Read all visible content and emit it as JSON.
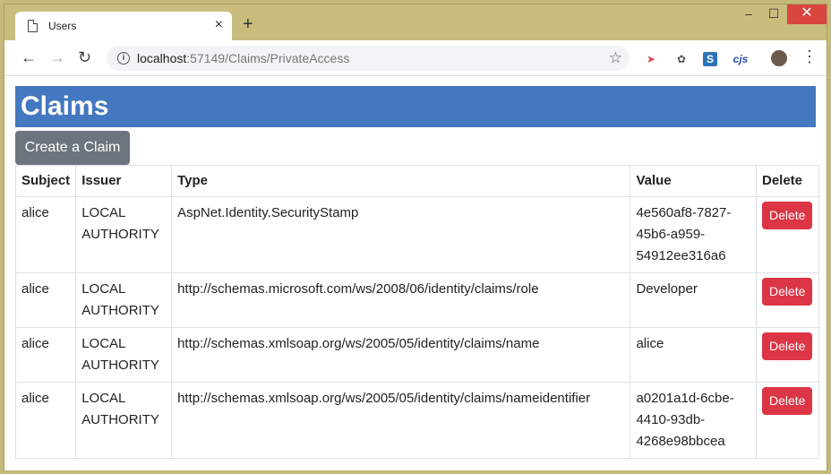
{
  "browser": {
    "tab_title": "Users",
    "tab_close": "×",
    "new_tab": "+",
    "minimize": "–",
    "maximize": "☐",
    "close": "✕",
    "url_host": "localhost",
    "url_path": ":57149/Claims/PrivateAccess",
    "ext4_label": "cjs"
  },
  "page": {
    "title": "Claims",
    "create_button": "Create a Claim",
    "columns": [
      "Subject",
      "Issuer",
      "Type",
      "Value",
      "Delete"
    ],
    "delete_label": "Delete",
    "rows": [
      {
        "subject": "alice",
        "issuer": "LOCAL AUTHORITY",
        "type": "AspNet.Identity.SecurityStamp",
        "value": "4e560af8-7827-45b6-a959-54912ee316a6"
      },
      {
        "subject": "alice",
        "issuer": "LOCAL AUTHORITY",
        "type": "http://schemas.microsoft.com/ws/2008/06/identity/claims/role",
        "value": "Developer"
      },
      {
        "subject": "alice",
        "issuer": "LOCAL AUTHORITY",
        "type": "http://schemas.xmlsoap.org/ws/2005/05/identity/claims/name",
        "value": "alice"
      },
      {
        "subject": "alice",
        "issuer": "LOCAL AUTHORITY",
        "type": "http://schemas.xmlsoap.org/ws/2005/05/identity/claims/nameidentifier",
        "value": "a0201a1d-6cbe-4410-93db-4268e98bbcea"
      }
    ]
  },
  "colors": {
    "heading_bg": "#4478c0",
    "create_button_bg": "#6c757d",
    "delete_button_bg": "#dc3545"
  },
  "icons": [
    "page-icon",
    "back-arrow-icon",
    "forward-arrow-icon",
    "reload-icon",
    "info-icon",
    "star-icon",
    "menu-dots-icon"
  ]
}
